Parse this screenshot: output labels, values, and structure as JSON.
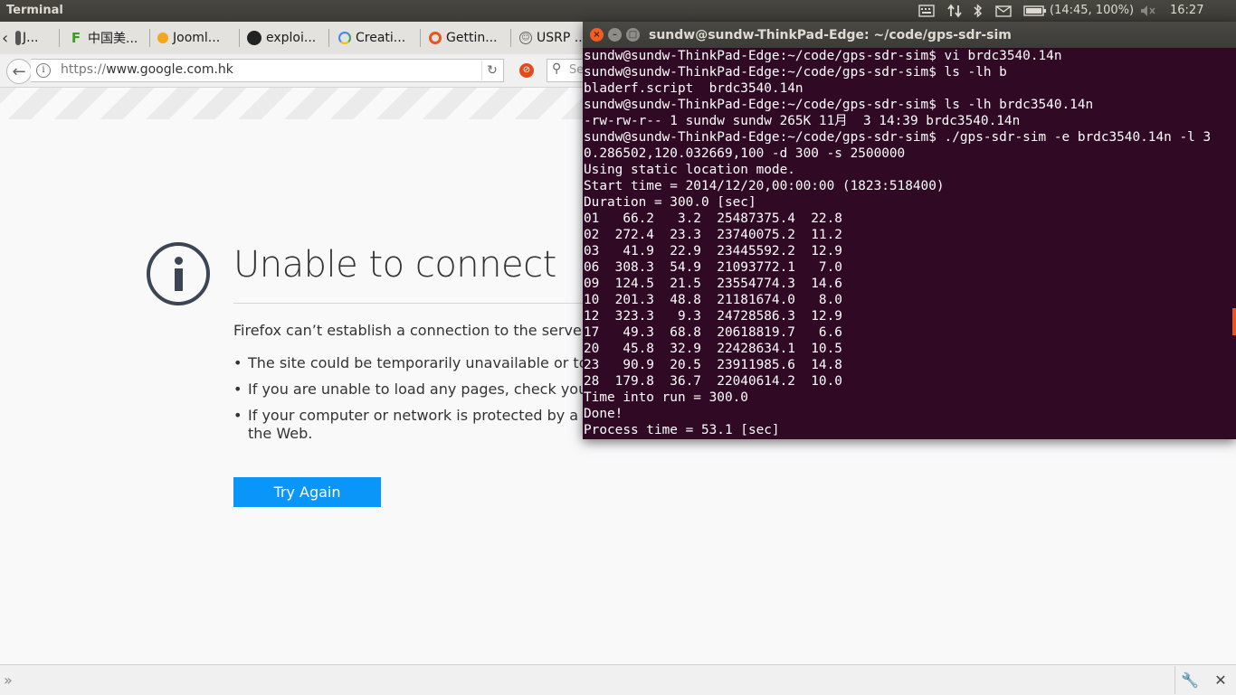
{
  "panel": {
    "title": "Terminal",
    "battery_text": "(14:45, 100%)",
    "clock": "16:27"
  },
  "tabs": [
    {
      "label": "J...",
      "icon": "ff-icon"
    },
    {
      "label": "中国美...",
      "icon": "green-f-icon"
    },
    {
      "label": "Jooml...",
      "icon": "joomla-icon"
    },
    {
      "label": "exploi...",
      "icon": "github-icon"
    },
    {
      "label": "Creati...",
      "icon": "google-icon"
    },
    {
      "label": "Gettin...",
      "icon": "ubuntu-icon"
    },
    {
      "label": "USRP ..",
      "icon": "smiley-icon"
    }
  ],
  "navbar": {
    "url_scheme": "https://",
    "url_host": "www.google.com.hk",
    "search_placeholder": "Se"
  },
  "error_page": {
    "title": "Unable to connect",
    "description": "Firefox can’t establish a connection to the server at",
    "reasons": [
      "The site could be temporarily unavailable or too b",
      "If you are unable to load any pages, check your co",
      "If your computer or network is protected by a fire",
      "the Web."
    ],
    "try_again": "Try Again"
  },
  "terminal": {
    "title": "sundw@sundw-ThinkPad-Edge: ~/code/gps-sdr-sim",
    "lines": [
      "sundw@sundw-ThinkPad-Edge:~/code/gps-sdr-sim$ vi brdc3540.14n",
      "sundw@sundw-ThinkPad-Edge:~/code/gps-sdr-sim$ ls -lh b",
      "bladerf.script  brdc3540.14n",
      "sundw@sundw-ThinkPad-Edge:~/code/gps-sdr-sim$ ls -lh brdc3540.14n",
      "-rw-rw-r-- 1 sundw sundw 265K 11月  3 14:39 brdc3540.14n",
      "sundw@sundw-ThinkPad-Edge:~/code/gps-sdr-sim$ ./gps-sdr-sim -e brdc3540.14n -l 3",
      "0.286502,120.032669,100 -d 300 -s 2500000",
      "Using static location mode.",
      "Start time = 2014/12/20,00:00:00 (1823:518400)",
      "Duration = 300.0 [sec]",
      "01   66.2   3.2  25487375.4  22.8",
      "02  272.4  23.3  23740075.2  11.2",
      "03   41.9  22.9  23445592.2  12.9",
      "06  308.3  54.9  21093772.1   7.0",
      "09  124.5  21.5  23554774.3  14.6",
      "10  201.3  48.8  21181674.0   8.0",
      "12  323.3   9.3  24728586.3  12.9",
      "17   49.3  68.8  20618819.7   6.6",
      "20   45.8  32.9  22428634.1  10.5",
      "23   90.9  20.5  23911985.6  14.8",
      "28  179.8  36.7  22040614.2  10.0",
      "Time into run = 300.0",
      "Done!",
      "Process time = 53.1 [sec]"
    ]
  }
}
